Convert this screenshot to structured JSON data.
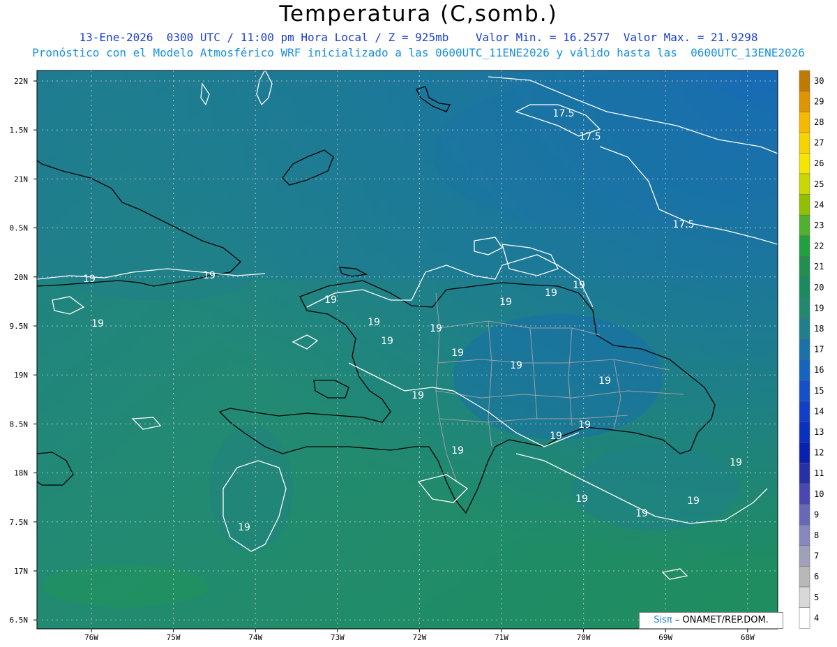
{
  "header": {
    "title": "Temperatura (C,somb.)",
    "line1": "13-Ene-2026  0300 UTC / 11:00 pm Hora Local / Z = 925mb    Valor Min. = 16.2577  Valor Max. = 21.9298",
    "line2": "Pronóstico con el Modelo Atmosférico WRF inicializado a las 0600UTC_11ENE2026 y válido hasta las  0600UTC_13ENE2026"
  },
  "axes": {
    "lat_labels": [
      "22N",
      "1.5N",
      "21N",
      "0.5N",
      "20N",
      "9.5N",
      "19N",
      "8.5N",
      "18N",
      "7.5N",
      "17N",
      "6.5N"
    ],
    "lon_labels": [
      "76W",
      "75W",
      "74W",
      "73W",
      "72W",
      "71W",
      "70W",
      "69W",
      "68W"
    ]
  },
  "colorbar": {
    "labels": [
      "30",
      "29",
      "28",
      "27",
      "26",
      "25",
      "24",
      "23",
      "22",
      "21",
      "20",
      "19",
      "18",
      "17",
      "16",
      "15",
      "14",
      "13",
      "12",
      "11",
      "10",
      "9",
      "8",
      "7",
      "6",
      "5",
      "4"
    ],
    "colors": [
      "#c07a00",
      "#e09400",
      "#f7b800",
      "#f7d400",
      "#f5e600",
      "#c8d800",
      "#90c000",
      "#50b030",
      "#20a040",
      "#209050",
      "#1a8a60",
      "#228870",
      "#1f7f8a",
      "#1a72a8",
      "#1565c0",
      "#1550c8",
      "#1040c8",
      "#0a30c0",
      "#0a20b0",
      "#2830a8",
      "#4848b0",
      "#6868b8",
      "#8888c0",
      "#a0a0b8",
      "#b8b8b8",
      "#d8d8d8",
      "#ffffff"
    ]
  },
  "contour_labels": [
    {
      "text": "17.5"
    },
    {
      "text": "17.5"
    },
    {
      "text": "17.5"
    },
    {
      "text": "19"
    },
    {
      "text": "19"
    },
    {
      "text": "19"
    },
    {
      "text": "19"
    },
    {
      "text": "19"
    },
    {
      "text": "19"
    },
    {
      "text": "19"
    },
    {
      "text": "19"
    },
    {
      "text": "19"
    },
    {
      "text": "19"
    },
    {
      "text": "19"
    },
    {
      "text": "19"
    },
    {
      "text": "19"
    },
    {
      "text": "19"
    },
    {
      "text": "19"
    },
    {
      "text": "19"
    },
    {
      "text": "19"
    },
    {
      "text": "19"
    },
    {
      "text": "19"
    },
    {
      "text": "19"
    },
    {
      "text": "19"
    },
    {
      "text": "19"
    }
  ],
  "credit": {
    "brand": "Sisπ",
    "text": " – ONAMET/REP.DOM."
  }
}
